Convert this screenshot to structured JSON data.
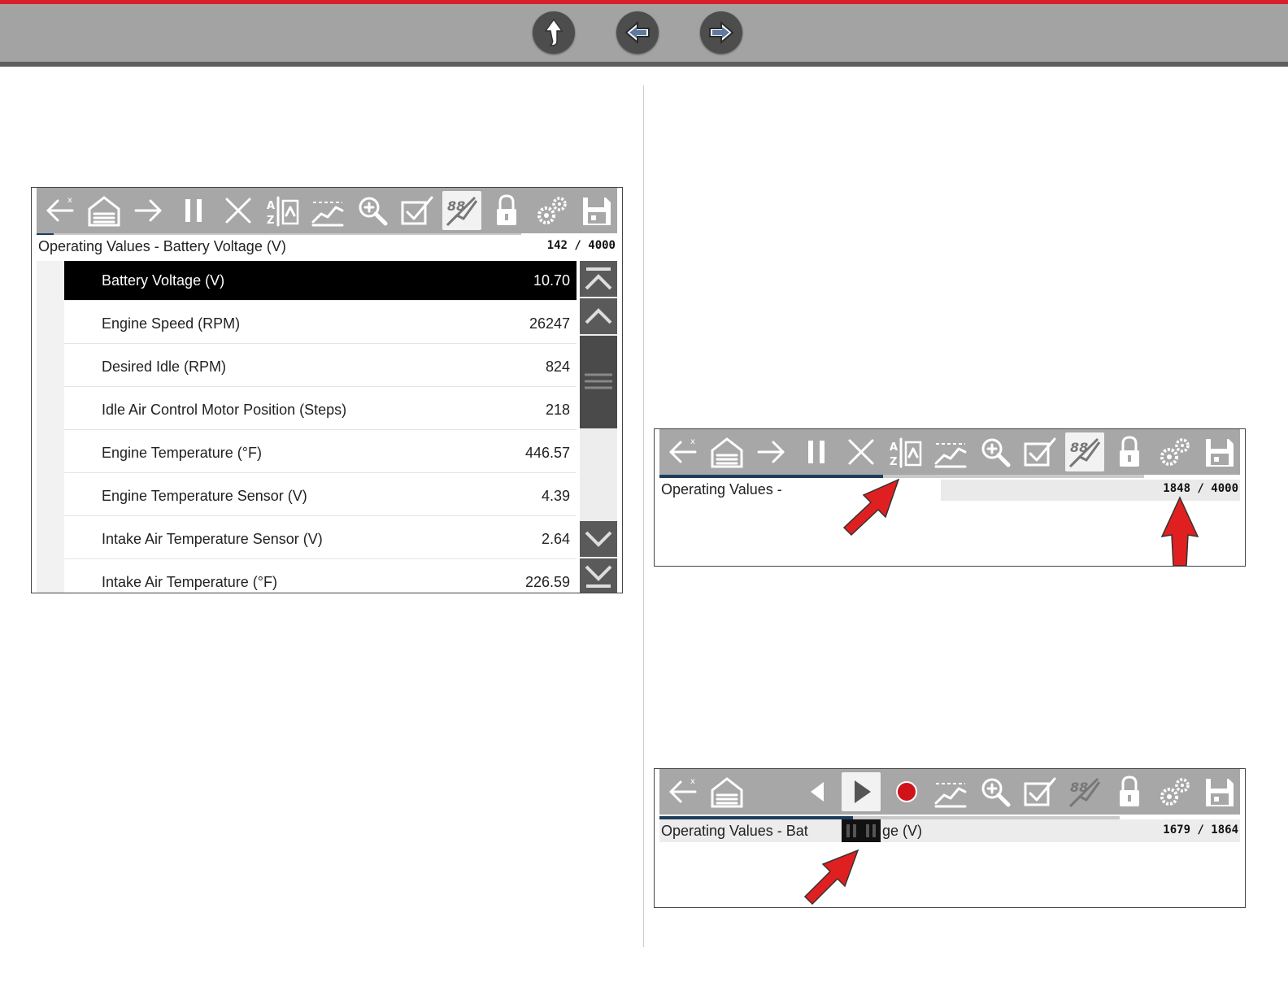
{
  "top_nav": {
    "buttons": [
      {
        "name": "up",
        "icon": "up-arrow-icon"
      },
      {
        "name": "back",
        "icon": "left-arrow-icon"
      },
      {
        "name": "forward",
        "icon": "right-arrow-icon"
      }
    ]
  },
  "panel1": {
    "toolbar_icons": [
      "back-exit-icon",
      "home-garage-icon",
      "forward-arrow-icon",
      "pause-icon",
      "clear-icon",
      "sort-icon",
      "graph-icon",
      "zoom-icon",
      "select-icon",
      "digital-view-icon",
      "lock-icon",
      "settings-icon",
      "save-icon"
    ],
    "active_icon": "digital-view-icon",
    "progress_fraction": 0.0355,
    "title": "Operating Values - Battery Voltage (V)",
    "counter": "142 / 4000",
    "rows": [
      {
        "name": "Battery Voltage (V)",
        "value": "10.70"
      },
      {
        "name": "Engine Speed (RPM)",
        "value": "26247"
      },
      {
        "name": "Desired Idle (RPM)",
        "value": "824"
      },
      {
        "name": "Idle Air Control Motor Position (Steps)",
        "value": "218"
      },
      {
        "name": "Engine Temperature (°F)",
        "value": "446.57"
      },
      {
        "name": "Engine Temperature Sensor (V)",
        "value": "4.39"
      },
      {
        "name": "Intake Air Temperature Sensor (V)",
        "value": "2.64"
      },
      {
        "name": "Intake Air Temperature (°F)",
        "value": "226.59"
      }
    ]
  },
  "panel2": {
    "toolbar_icons": [
      "back-exit-icon",
      "home-garage-icon",
      "forward-arrow-icon",
      "pause-icon",
      "clear-icon",
      "sort-icon",
      "graph-icon",
      "zoom-icon",
      "select-icon",
      "digital-view-icon",
      "lock-icon",
      "settings-icon",
      "save-icon"
    ],
    "active_icon": "digital-view-icon",
    "progress_fraction": 0.462,
    "title": "Operating Values -",
    "counter": "1848 / 4000"
  },
  "panel3": {
    "toolbar_icons": [
      "back-exit-icon",
      "home-garage-icon",
      "step-back-icon",
      "play-icon",
      "record-icon",
      "graph-icon",
      "zoom-icon",
      "select-icon",
      "digital-view-icon",
      "lock-icon",
      "settings-icon",
      "save-icon"
    ],
    "progress_fraction": 0.42,
    "title_start": "Operating Values - Bat",
    "title_end": "ge (V)",
    "counter": "1679 / 1864"
  },
  "colors": {
    "brand_red": "#d8202a",
    "toolbar_gray": "#a7a7a7",
    "progress_blue": "#1f3d5c",
    "callout_red": "#e02020"
  }
}
